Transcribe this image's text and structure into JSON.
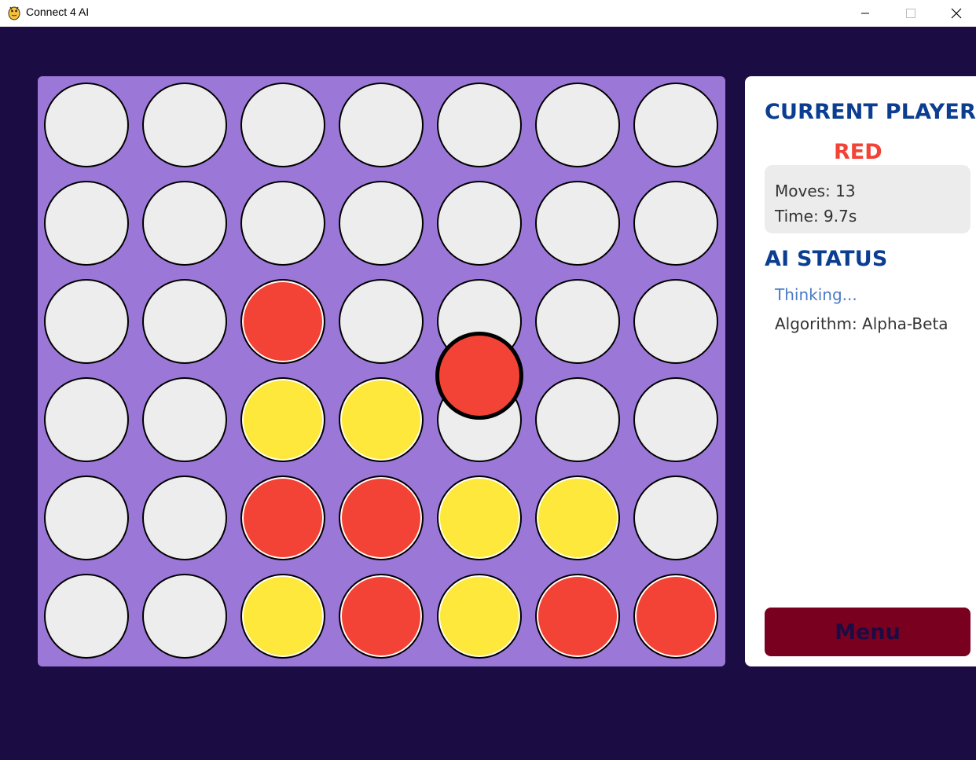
{
  "window": {
    "title": "Connect 4 AI",
    "icon": "python-icon"
  },
  "board": {
    "rows": 6,
    "cols": 7,
    "grid": [
      [
        "empty",
        "empty",
        "empty",
        "empty",
        "empty",
        "empty",
        "empty"
      ],
      [
        "empty",
        "empty",
        "empty",
        "empty",
        "empty",
        "empty",
        "empty"
      ],
      [
        "empty",
        "empty",
        "red",
        "empty",
        "empty",
        "empty",
        "empty"
      ],
      [
        "empty",
        "empty",
        "yellow",
        "yellow",
        "empty",
        "empty",
        "empty"
      ],
      [
        "empty",
        "empty",
        "red",
        "red",
        "yellow",
        "yellow",
        "empty"
      ],
      [
        "empty",
        "empty",
        "yellow",
        "red",
        "yellow",
        "red",
        "red"
      ]
    ],
    "falling_disc": {
      "color": "red",
      "column": 4,
      "row_progress": 2.55
    },
    "colors": {
      "board": "#9b78d7",
      "empty": "#ededed",
      "red": "#f34336",
      "yellow": "#fde83b"
    }
  },
  "panel": {
    "current_player_heading": "CURRENT PLAYER",
    "current_player": "RED",
    "moves": "Moves: 13",
    "time": "Time: 9.7s",
    "ai_status_heading": "AI STATUS",
    "ai_state": "Thinking...",
    "algorithm": "Algorithm: Alpha-Beta",
    "menu_label": "Menu"
  },
  "colors": {
    "background": "#1b0c44",
    "heading": "#0b3e91",
    "menu_button": "#7a0020"
  }
}
